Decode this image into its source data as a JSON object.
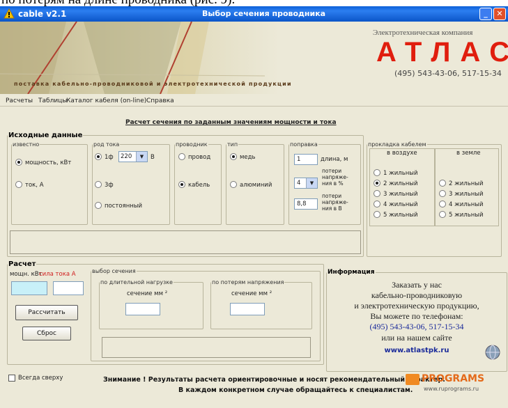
{
  "cropped_heading": "по потерям на длине проводника (рис. 9).",
  "window": {
    "app_name": "cable v2.1",
    "title": "Выбор сечения проводника",
    "min_symbol": "_",
    "close_symbol": "✕"
  },
  "banner": {
    "company": "Электротехническая компания",
    "logo": "АТЛАС",
    "phone": "(495) 543-43-06, 517-15-34",
    "strip": "поставка кабельно-проводниковой и электротехнической продукции"
  },
  "menu": [
    "Расчеты",
    "Таблицы",
    "Каталог кабеля (on-line)",
    "Справка"
  ],
  "heading": "Расчет сечения по заданным значениям мощности и тока",
  "source_section": {
    "legend": "Исходные данные",
    "known": {
      "legend": "известно",
      "options": [
        "мощность, кВт",
        "ток, А"
      ],
      "selected": 0
    },
    "current_type": {
      "legend": "род тока",
      "options": [
        "1ф",
        "3ф",
        "постоянный"
      ],
      "selected": 0,
      "voltage": "220",
      "unit": "В"
    },
    "conductor": {
      "legend": "проводник",
      "options": [
        "провод",
        "кабель"
      ],
      "selected": 1
    },
    "material": {
      "legend": "тип",
      "options": [
        "медь",
        "алюминий"
      ],
      "selected": 0
    },
    "correction": {
      "legend": "поправка",
      "length_value": "1",
      "length_label": "длина, м",
      "loss_pct_value": "4",
      "loss_pct_label": "потери напряже-ния в %",
      "loss_v_value": "8,8",
      "loss_v_label": "потери напряже-ния в В"
    },
    "laying": {
      "legend": "прокладка кабелем",
      "air_label": "в воздухе",
      "ground_label": "в земле",
      "air_options": [
        "1 жильный",
        "2 жильный",
        "3 жильный",
        "4 жильный",
        "5 жильный"
      ],
      "ground_options": [
        "2 жильный",
        "3 жильный",
        "4 жильный",
        "5 жильный"
      ],
      "selected_air": 1
    },
    "status": ""
  },
  "calc_section": {
    "legend": "Расчет",
    "power_label": "мощн. кВт",
    "current_label": "сила тока А",
    "power_value": "",
    "current_value": "",
    "calc_button": "Рассчитать",
    "reset_button": "Сброс",
    "choice_legend": "выбор сечения",
    "long_load_legend": "по длительной нагрузке",
    "voltage_loss_legend": "по потерям напряжения",
    "section_label": "сечение мм ²",
    "long_load_value": "",
    "voltage_loss_value": "",
    "result": ""
  },
  "info": {
    "legend": "Информация",
    "lines": [
      "Заказать у нас",
      "кабельно-проводниковую",
      "и электротехническую продукцию,",
      "Вы можете по телефонам:"
    ],
    "phones": "(495) 543-43-06, 517-15-34",
    "or_site": "или на нашем сайте",
    "site": "www.atlastpk.ru"
  },
  "footer": {
    "always_on_top": "Всегда сверху",
    "warning_1": "Знимание !  Результаты расчета ориентировочные и носят рекомендательный характер.",
    "warning_2": "В каждом конкретном случае обращайтесь к специалистам.",
    "brand": "PROGRAMS",
    "brand_url": "www.ruprograms.ru"
  },
  "colors": {
    "titlebar": "#0a5fd8",
    "logo": "#e01e0e",
    "window": "#ece9d8",
    "highlight_input": "#c8f0f8",
    "label_red": "#d02020"
  }
}
